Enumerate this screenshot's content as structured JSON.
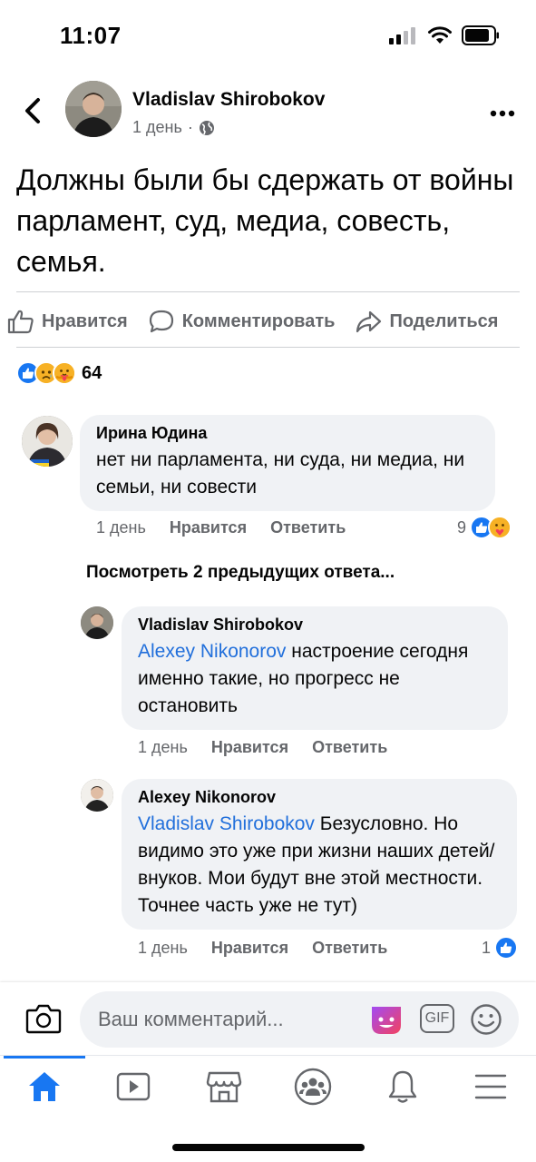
{
  "status_bar": {
    "time": "11:07"
  },
  "post": {
    "author": "Vladislav Shirobokov",
    "time": "1 день",
    "separator": "·",
    "text": "Должны были бы сдержать от войны парламент, суд, медиа, совесть, семья."
  },
  "actions": {
    "like": "Нравится",
    "comment": "Комментировать",
    "share": "Поделиться"
  },
  "reactions": {
    "count": "64"
  },
  "comments": [
    {
      "author": "Ирина Юдина",
      "text": "нет ни парламента, ни суда, ни медиа, ни семьи, ни совести",
      "time": "1 день",
      "like": "Нравится",
      "reply": "Ответить",
      "reaction_count": "9"
    }
  ],
  "view_previous": "Посмотреть 2 предыдущих ответа...",
  "replies": [
    {
      "author": "Vladislav Shirobokov",
      "mention": "Alexey Nikonorov",
      "text": " настроение сегодня именно такие, но прогресс не остановить",
      "time": "1 день",
      "like": "Нравится",
      "reply": "Ответить"
    },
    {
      "author": "Alexey Nikonorov",
      "mention": "Vladislav Shirobokov",
      "text": " Безусловно. Но видимо это уже при жизни наших детей/внуков. Мои будут вне этой местности. Точнее часть уже не тут)",
      "time": "1 день",
      "like": "Нравится",
      "reply": "Ответить",
      "reaction_count": "1"
    }
  ],
  "composer": {
    "placeholder": "Ваш комментарий...",
    "gif_label": "GIF"
  },
  "colors": {
    "accent": "#1877f2",
    "mention": "#216fdb",
    "bubble": "#f0f2f5",
    "secondary_text": "#65676b"
  },
  "tabs": [
    "home-icon",
    "video-icon",
    "marketplace-icon",
    "groups-icon",
    "notifications-icon",
    "menu-icon"
  ]
}
